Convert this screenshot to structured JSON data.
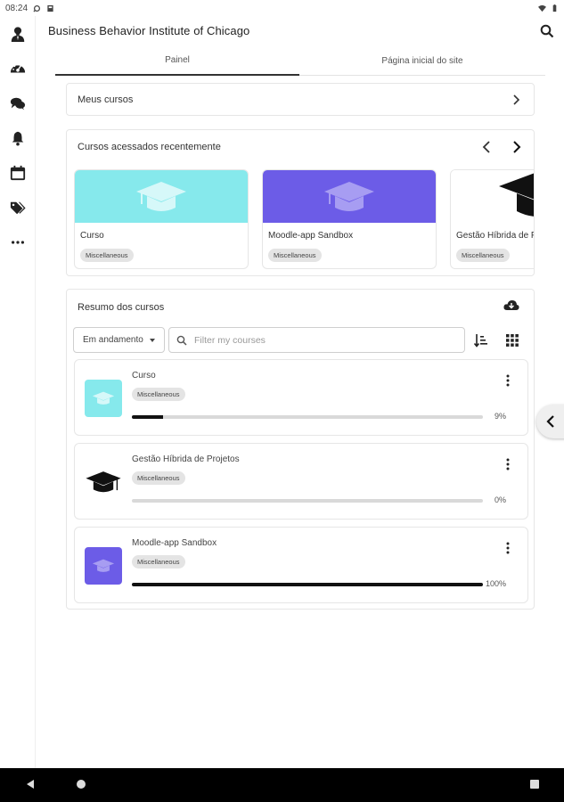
{
  "status_bar": {
    "time": "08:24"
  },
  "header": {
    "title": "Business Behavior Institute of Chicago"
  },
  "tabs": [
    {
      "label": "Painel",
      "active": true
    },
    {
      "label": "Página inicial do site",
      "active": false
    }
  ],
  "meus_cursos": {
    "label": "Meus cursos"
  },
  "recent": {
    "title": "Cursos acessados recentemente",
    "courses": [
      {
        "name": "Curso",
        "category": "Miscellaneous",
        "color": "#86E9EC"
      },
      {
        "name": "Moodle-app Sandbox",
        "category": "Miscellaneous",
        "color": "#6C5CE7"
      },
      {
        "name": "Gestão Híbrida de Projetos",
        "category": "Miscellaneous",
        "color": "#FFFFFF"
      }
    ]
  },
  "resumo": {
    "title": "Resumo dos cursos",
    "filter_select": "Em andamento",
    "search_placeholder": "Filter my courses",
    "courses": [
      {
        "name": "Curso",
        "category": "Miscellaneous",
        "progress": 9,
        "progress_label": "9%",
        "thumb_color": "#86E9EC"
      },
      {
        "name": "Gestão Híbrida de Projetos",
        "category": "Miscellaneous",
        "progress": 0,
        "progress_label": "0%",
        "thumb_color": "#FFFFFF"
      },
      {
        "name": "Moodle-app Sandbox",
        "category": "Miscellaneous",
        "progress": 100,
        "progress_label": "100%",
        "thumb_color": "#6C5CE7"
      }
    ]
  },
  "icons": {
    "rail": [
      "user-avatar-icon",
      "dashboard-icon",
      "messages-icon",
      "notifications-icon",
      "calendar-icon",
      "tags-icon",
      "more-icon"
    ]
  }
}
